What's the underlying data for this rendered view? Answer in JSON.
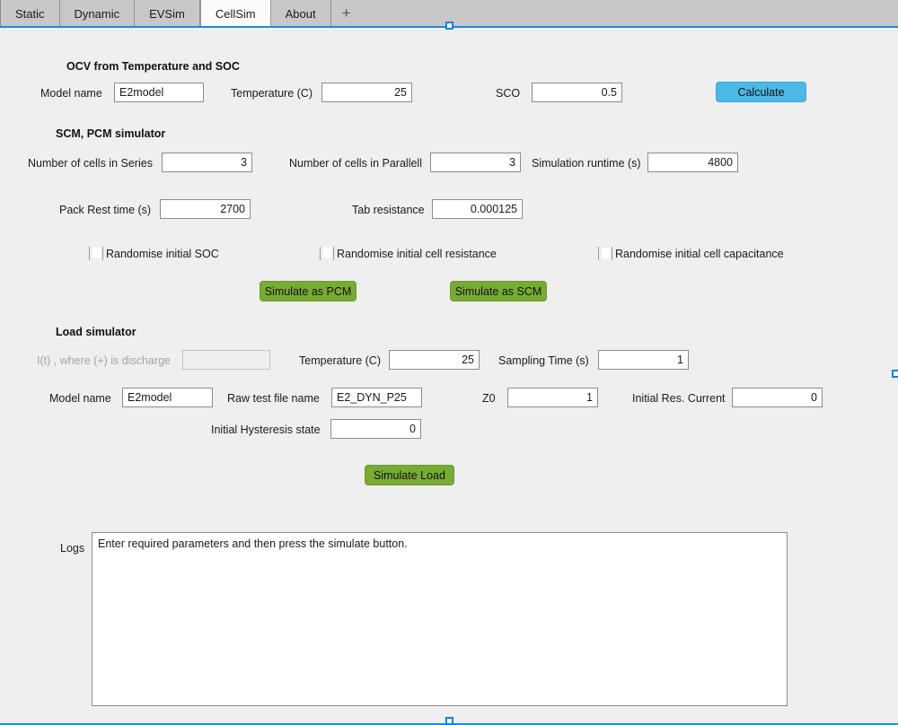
{
  "tabs": {
    "items": [
      {
        "label": "Static",
        "active": false
      },
      {
        "label": "Dynamic",
        "active": false
      },
      {
        "label": "EVSim",
        "active": false
      },
      {
        "label": "CellSim",
        "active": true
      },
      {
        "label": "About",
        "active": false
      }
    ],
    "add_label": "+"
  },
  "ocv_section": {
    "title": "OCV from Temperature and SOC",
    "model_name_label": "Model name",
    "model_name_value": "E2model",
    "temperature_label": "Temperature (C)",
    "temperature_value": "25",
    "sco_label": "SCO",
    "sco_value": "0.5",
    "calculate_label": "Calculate"
  },
  "pack_section": {
    "title": "SCM, PCM simulator",
    "series_label": "Number of cells in Series",
    "series_value": "3",
    "parallel_label": "Number of cells in Parallell",
    "parallel_value": "3",
    "runtime_label": "Simulation runtime (s)",
    "runtime_value": "4800",
    "rest_time_label": "Pack Rest time (s)",
    "rest_time_value": "2700",
    "tab_resistance_label": "Tab resistance",
    "tab_resistance_value": "0.000125",
    "checkbox_soc_label": "Randomise initial SOC",
    "checkbox_resistance_label": "Randomise initial cell resistance",
    "checkbox_capacitance_label": "Randomise initial cell capacitance",
    "simulate_pcm_label": "Simulate as PCM",
    "simulate_scm_label": "Simulate as SCM"
  },
  "load_section": {
    "title": "Load simulator",
    "current_label": "I(t) , where (+) is discharge",
    "current_value": "",
    "temperature_label": "Temperature (C)",
    "temperature_value": "25",
    "sampling_time_label": "Sampling Time (s)",
    "sampling_time_value": "1",
    "model_name_label": "Model name",
    "model_name_value": "E2model",
    "raw_test_file_label": "Raw test file name",
    "raw_test_file_value": "E2_DYN_P25",
    "z0_label": "Z0",
    "z0_value": "1",
    "initial_res_current_label": "Initial Res. Current",
    "initial_res_current_value": "0",
    "initial_hysteresis_label": "Initial Hysteresis state",
    "initial_hysteresis_value": "0",
    "simulate_load_label": "Simulate Load"
  },
  "logs": {
    "label": "Logs",
    "text": "Enter required parameters and then press the simulate button."
  },
  "colors": {
    "accent_blue": "#4cb8e8",
    "selection_blue": "#0a84e0",
    "simulate_green": "#78ab32",
    "panel_background": "#efefef",
    "tabbar_background": "#c8c8c8"
  }
}
